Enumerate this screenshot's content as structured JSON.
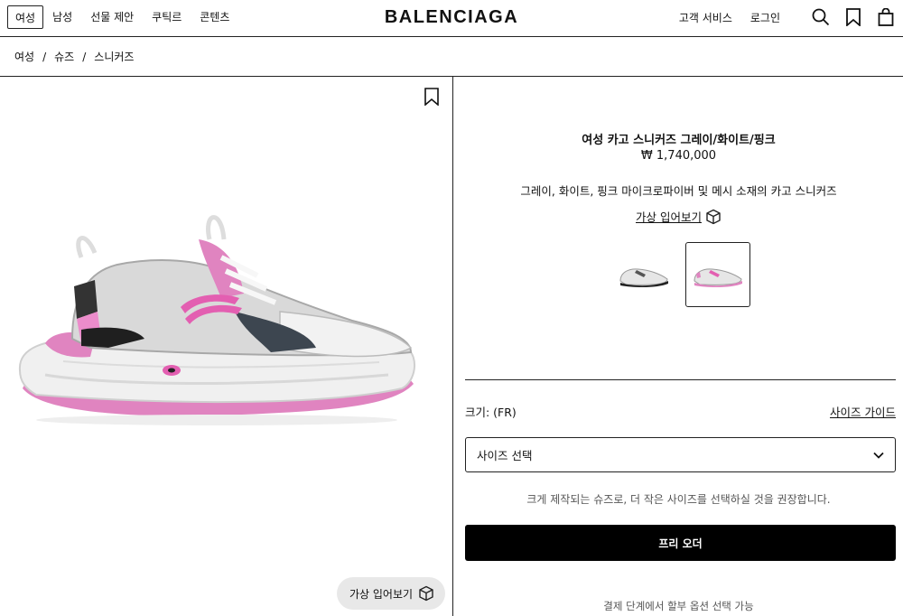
{
  "header": {
    "nav": [
      "여성",
      "남성",
      "선물 제안",
      "쿠틱르",
      "콘텐츠"
    ],
    "logo": "BALENCIAGA",
    "customer_service": "고객 서비스",
    "login": "로그인"
  },
  "breadcrumb": [
    "여성",
    "슈즈",
    "스니커즈"
  ],
  "product": {
    "title": "여성 카고 스니커즈 그레이/화이트/핑크",
    "price": "₩ 1,740,000",
    "description": "그레이, 화이트, 핑크 마이크로파이버 및 메시 소재의 카고 스니커즈",
    "virtual_try_on": "가상 입어보기",
    "size_label": "크기: (FR)",
    "size_guide": "사이즈 가이드",
    "size_select_placeholder": "사이즈 선택",
    "size_note": "크게 제작되는 슈즈로, 더 작은 사이즈를 선택하실 것을 권장합니다.",
    "preorder_button": "프리 오더",
    "installment_note": "결제 단계에서 할부 옵션 선택 가능"
  },
  "image_panel": {
    "virtual_try_on_button": "가상 입어보기"
  },
  "colors": {
    "accent_pink": "#e67bbf",
    "black": "#000000"
  }
}
